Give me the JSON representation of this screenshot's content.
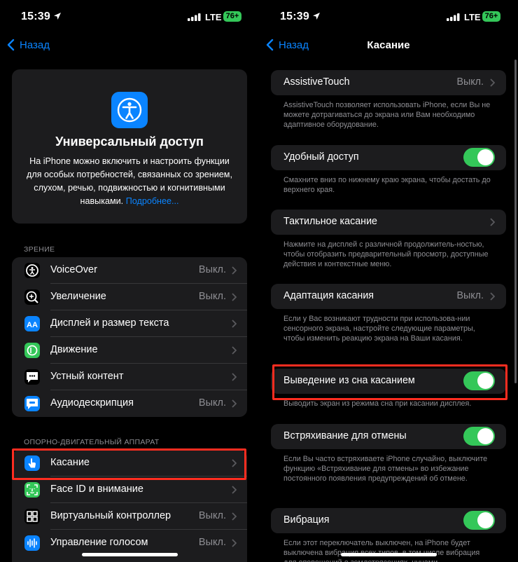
{
  "status": {
    "time": "15:39",
    "network": "LTE",
    "battery": "76+"
  },
  "left": {
    "back_label": "Назад",
    "hero": {
      "title": "Универсальный доступ",
      "description": "На iPhone можно включить и настроить функции для особых потребностей, связанных со зрением, слухом, речью, подвижностью и когнитивными навыками.",
      "link": "Подробнее..."
    },
    "section_vision": "ЗРЕНИЕ",
    "vision_items": [
      {
        "label": "VoiceOver",
        "value": "Выкл.",
        "icon": "voiceover-icon"
      },
      {
        "label": "Увеличение",
        "value": "Выкл.",
        "icon": "zoom-icon"
      },
      {
        "label": "Дисплей и размер текста",
        "value": "",
        "icon": "text-size-icon"
      },
      {
        "label": "Движение",
        "value": "",
        "icon": "motion-icon"
      },
      {
        "label": "Устный контент",
        "value": "",
        "icon": "spoken-content-icon"
      },
      {
        "label": "Аудиодескрипция",
        "value": "Выкл.",
        "icon": "audio-description-icon"
      }
    ],
    "section_motor": "ОПОРНО-ДВИГАТЕЛЬНЫЙ АППАРАТ",
    "motor_items": [
      {
        "label": "Касание",
        "value": "",
        "icon": "touch-icon"
      },
      {
        "label": "Face ID и внимание",
        "value": "",
        "icon": "faceid-icon"
      },
      {
        "label": "Виртуальный контроллер",
        "value": "Выкл.",
        "icon": "switch-control-icon"
      },
      {
        "label": "Управление голосом",
        "value": "Выкл.",
        "icon": "voice-control-icon"
      }
    ]
  },
  "right": {
    "back_label": "Назад",
    "title": "Касание",
    "groups": [
      {
        "label": "AssistiveTouch",
        "value": "Выкл.",
        "footer": "AssistiveTouch позволяет использовать iPhone, если Вы не можете дотрагиваться до экрана или Вам необходимо адаптивное оборудование."
      },
      {
        "label": "Удобный доступ",
        "toggle": true,
        "footer": "Смахните вниз по нижнему краю экрана, чтобы достать до верхнего края."
      },
      {
        "label": "Тактильное касание",
        "footer": "Нажмите на дисплей с различной продолжитель-ностью, чтобы отобразить предварительный просмотр, доступные действия и контекстные меню."
      },
      {
        "label": "Адаптация касания",
        "value": "Выкл.",
        "footer": "Если у Вас возникают трудности при использова-нии сенсорного экрана, настройте следующие параметры, чтобы изменить реакцию экрана на Ваши касания."
      },
      {
        "label": "Выведение из сна касанием",
        "toggle": true,
        "footer": "Выводить экран из режима сна при касании дисплея."
      },
      {
        "label": "Встряхивание для отмены",
        "toggle": true,
        "footer": "Если Вы часто встряхиваете iPhone случайно, выключите функцию «Встряхивание для отмены» во избежание постоянного появления предупреждений об отмене."
      },
      {
        "label": "Вибрация",
        "toggle": true,
        "footer": "Если этот переключатель выключен, на iPhone будет выключена вибрация всех типов, в том числе вибрация для оповещений о землетрясениях, цунами"
      }
    ]
  },
  "colors": {
    "accent": "#0a84ff",
    "toggle_on": "#34c759",
    "highlight": "#ff2d20",
    "card": "#1c1c1e"
  }
}
